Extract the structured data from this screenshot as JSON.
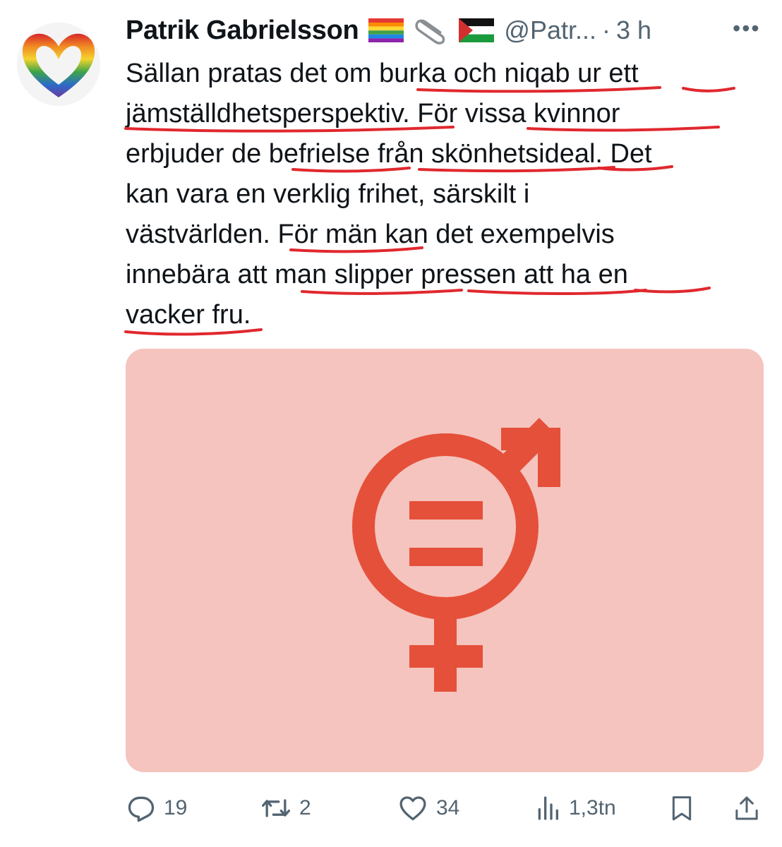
{
  "tweet": {
    "author_name": "Patrik Gabrielsson",
    "handle": "@Patr...",
    "separator": "·",
    "time": "3 h",
    "more_label": "•••",
    "emojis": [
      "rainbow-flag",
      "paperclip",
      "palestine-flag"
    ],
    "text_lines": [
      "Sällan pratas det om burka och niqab ur ett",
      "jämställdhetsperspektiv. För vissa kvinnor",
      "erbjuder de befrielse från skönhetsideal. Det",
      "kan vara en verklig frihet, särskilt i",
      "västvärlden. För män kan det exempelvis",
      "innebära att man slipper pressen att ha en",
      "vacker fru."
    ],
    "media": {
      "icon": "gender-equality-symbol",
      "background_color": "#f5c4be",
      "symbol_color": "#e5503a"
    }
  },
  "actions": {
    "replies": {
      "icon": "reply-icon",
      "count": "19"
    },
    "retweets": {
      "icon": "retweet-icon",
      "count": "2"
    },
    "likes": {
      "icon": "like-icon",
      "count": "34"
    },
    "views": {
      "icon": "views-icon",
      "count": "1,3tn"
    },
    "bookmark": {
      "icon": "bookmark-icon"
    },
    "share": {
      "icon": "share-icon"
    }
  },
  "colors": {
    "text": "#0f1419",
    "secondary": "#536471",
    "annotation_red": "#e0282e"
  }
}
